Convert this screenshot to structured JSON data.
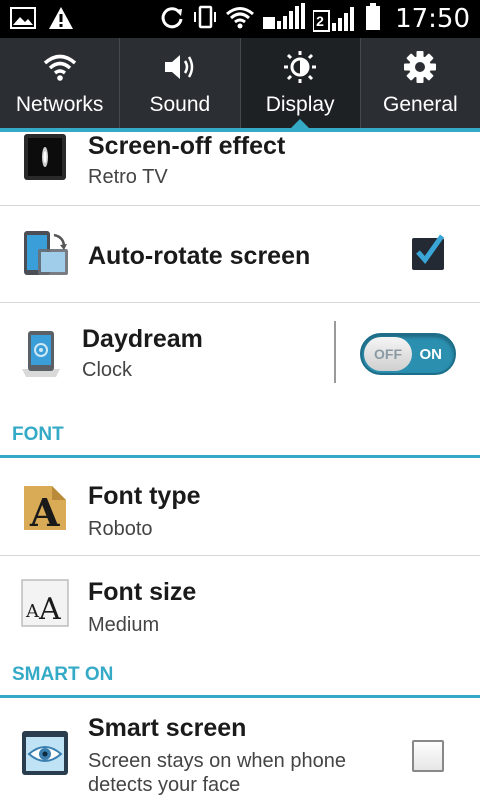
{
  "status_bar": {
    "time": "17:50",
    "sim2_label": "2"
  },
  "tabs": [
    {
      "label": "Networks",
      "icon": "wifi-icon",
      "active": false
    },
    {
      "label": "Sound",
      "icon": "speaker-icon",
      "active": false
    },
    {
      "label": "Display",
      "icon": "brightness-icon",
      "active": true
    },
    {
      "label": "General",
      "icon": "gear-icon",
      "active": false
    }
  ],
  "settings": {
    "screen_off": {
      "title": "Screen-off effect",
      "subtitle": "Retro TV"
    },
    "auto_rotate": {
      "title": "Auto-rotate screen",
      "checked": true
    },
    "daydream": {
      "title": "Daydream",
      "subtitle": "Clock",
      "toggle_off": "OFF",
      "toggle_on": "ON",
      "enabled": true
    },
    "font_section": "FONT",
    "font_type": {
      "title": "Font type",
      "subtitle": "Roboto"
    },
    "font_size": {
      "title": "Font size",
      "subtitle": "Medium"
    },
    "smart_on_section": "SMART ON",
    "smart_screen": {
      "title": "Smart screen",
      "subtitle_line1": "Screen stays on when phone",
      "subtitle_line2": "detects your face",
      "checked": false
    }
  },
  "colors": {
    "accent": "#35aac7",
    "tabbar": "#2b2f33"
  }
}
